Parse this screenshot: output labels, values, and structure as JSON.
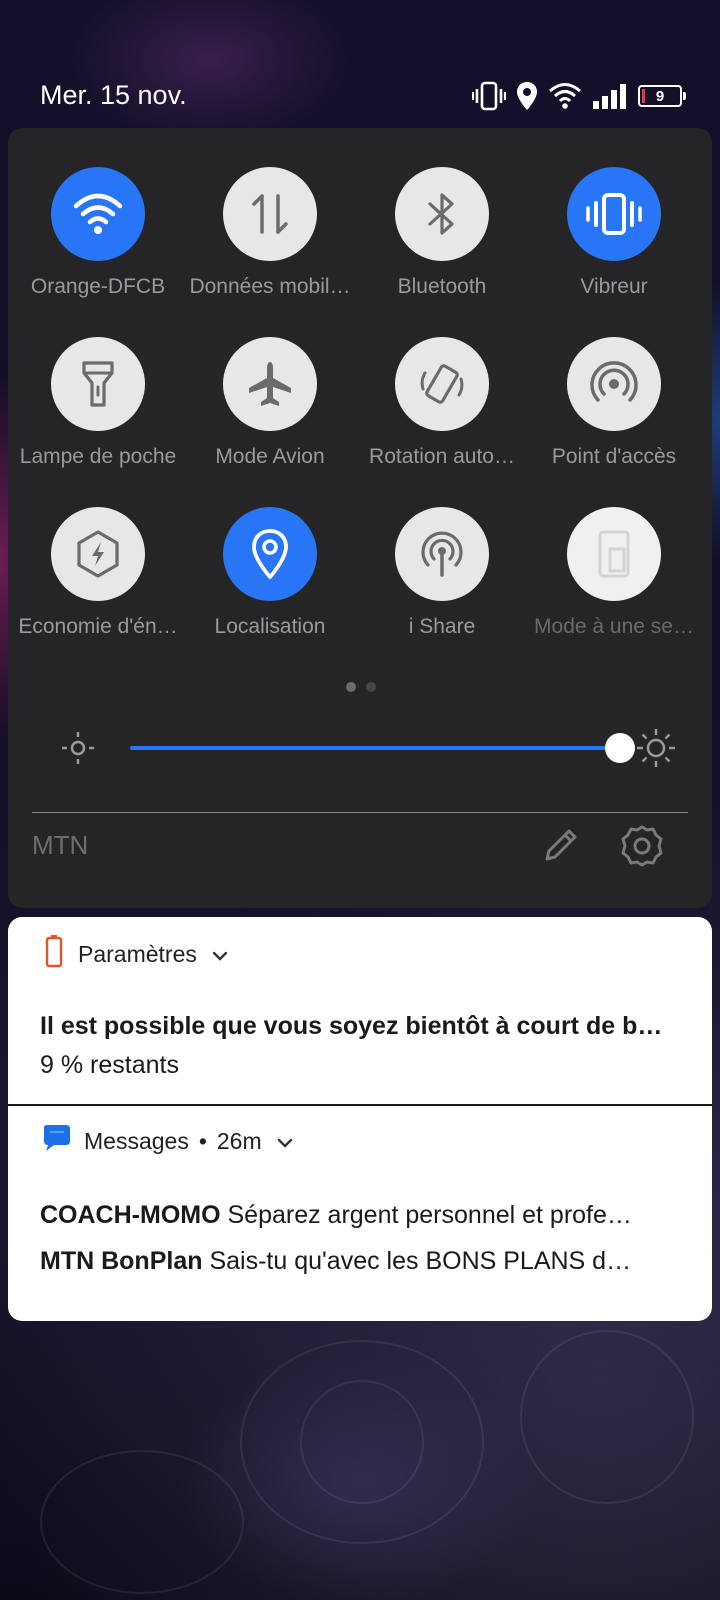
{
  "status_bar": {
    "date": "Mer. 15 nov.",
    "battery_level": "9",
    "icons": [
      "vibrate-icon",
      "location-icon",
      "wifi-icon",
      "signal-icon",
      "battery-icon"
    ]
  },
  "quick_settings": {
    "tiles": [
      {
        "label": "Orange-DFCB",
        "icon": "wifi-icon",
        "state": "on"
      },
      {
        "label": "Données mobil…",
        "icon": "mobile-data-icon",
        "state": "off"
      },
      {
        "label": "Bluetooth",
        "icon": "bluetooth-icon",
        "state": "off"
      },
      {
        "label": "Vibreur",
        "icon": "vibrate-icon",
        "state": "on"
      },
      {
        "label": "Lampe de poche",
        "icon": "flashlight-icon",
        "state": "off"
      },
      {
        "label": "Mode Avion",
        "icon": "airplane-icon",
        "state": "off"
      },
      {
        "label": "Rotation auto…",
        "icon": "rotation-icon",
        "state": "off"
      },
      {
        "label": "Point d'accès",
        "icon": "hotspot-icon",
        "state": "off"
      },
      {
        "label": "Economie d'én…",
        "icon": "battery-saver-icon",
        "state": "off"
      },
      {
        "label": "Localisation",
        "icon": "location-icon",
        "state": "on"
      },
      {
        "label": "i Share",
        "icon": "ishare-icon",
        "state": "off"
      },
      {
        "label": "Mode à une se…",
        "icon": "one-hand-mode-icon",
        "state": "disabled"
      }
    ],
    "page_count": 2,
    "current_page": 1,
    "brightness_percent": 100,
    "carrier": "MTN",
    "accent_color": "#2876f5"
  },
  "notifications": {
    "battery": {
      "app": "Paramètres",
      "title": "Il est possible que vous soyez bientôt à court de b…",
      "text": "9 % restants"
    },
    "messages": {
      "app": "Messages",
      "separator": "•",
      "time": "26m",
      "items": [
        {
          "sender": "COACH-MOMO",
          "text": "Séparez argent personnel et profe…"
        },
        {
          "sender": "MTN BonPlan",
          "text": "Sais-tu qu'avec les BONS PLANS d…"
        }
      ]
    }
  }
}
